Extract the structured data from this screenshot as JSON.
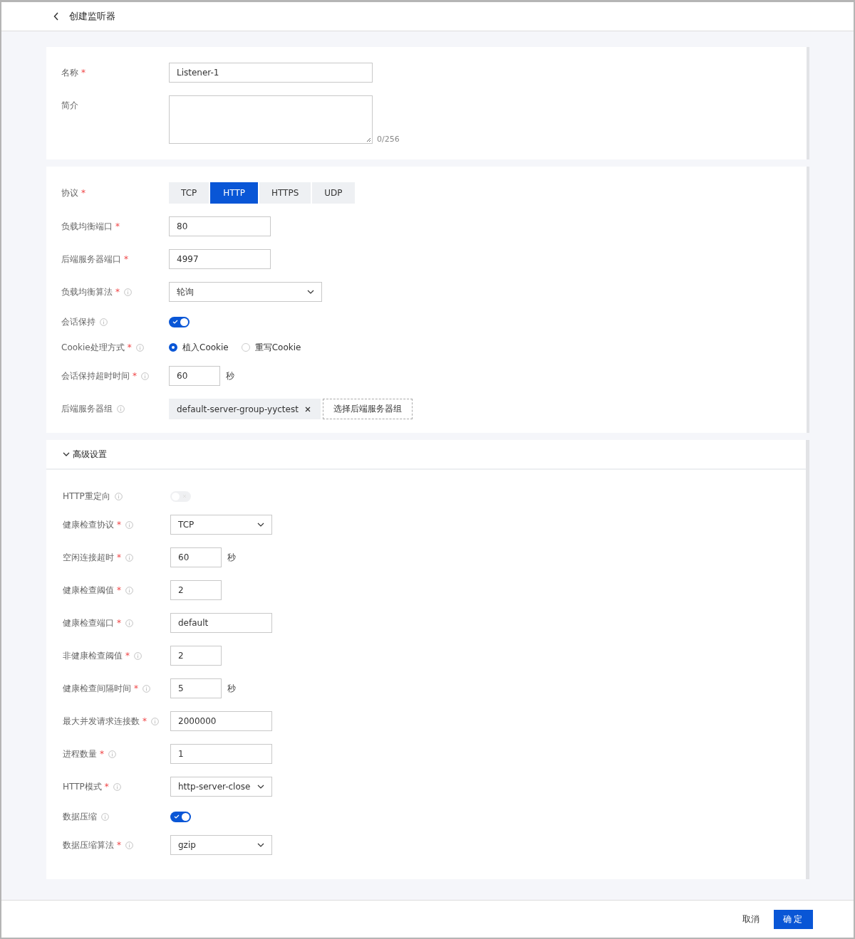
{
  "header": {
    "title": "创建监听器"
  },
  "basic": [
    {
      "kind": "text",
      "label": "名称",
      "mark": "*",
      "value": "Listener-1"
    },
    {
      "kind": "textarea",
      "label": "简介",
      "counter": "0/256"
    }
  ],
  "listener": [
    {
      "kind": "segmented",
      "label": "协议",
      "mark": "*",
      "options": [
        {
          "label": "TCP",
          "selected": false
        },
        {
          "label": "HTTP",
          "selected": true
        },
        {
          "label": "HTTPS",
          "selected": false
        },
        {
          "label": "UDP",
          "selected": false
        }
      ]
    },
    {
      "kind": "text",
      "label": "负载均衡端口",
      "mark": "*",
      "value": "80"
    },
    {
      "kind": "text",
      "label": "后端服务器端口",
      "mark": "*",
      "value": "4997"
    },
    {
      "kind": "select",
      "label": "负载均衡算法",
      "mark": "*",
      "info": true,
      "value": "轮询"
    },
    {
      "kind": "switch",
      "label": "会话保持",
      "info": true,
      "on": true,
      "disabled": false
    },
    {
      "kind": "radio",
      "label": "Cookie处理方式",
      "mark": "*",
      "info": true,
      "options": [
        {
          "label": "植入Cookie",
          "selected": true
        },
        {
          "label": "重写Cookie",
          "selected": false
        }
      ]
    },
    {
      "kind": "text",
      "label": "会话保持超时时间",
      "mark": "*",
      "info": true,
      "value": "60",
      "unit": "秒"
    },
    {
      "kind": "tags",
      "label": "后端服务器组",
      "info": true,
      "tags": [
        "default-server-group-yyctest"
      ],
      "action": "选择后端服务器组"
    }
  ],
  "advanced": {
    "title": "高级设置",
    "expanded": true,
    "fields": [
      {
        "kind": "switch",
        "label": "HTTP重定向",
        "info": true,
        "on": false,
        "disabled": true
      },
      {
        "kind": "select",
        "label": "健康检查协议",
        "mark": "*",
        "info": true,
        "value": "TCP"
      },
      {
        "kind": "text",
        "label": "空闲连接超时",
        "mark": "*",
        "info": true,
        "value": "60",
        "unit": "秒"
      },
      {
        "kind": "text",
        "label": "健康检查阈值",
        "mark": "*",
        "info": true,
        "value": "2"
      },
      {
        "kind": "text",
        "label": "健康检查端口",
        "mark": "*",
        "info": true,
        "value": "default"
      },
      {
        "kind": "text",
        "label": "非健康检查阈值",
        "mark": "*",
        "info": true,
        "value": "2"
      },
      {
        "kind": "text",
        "label": "健康检查间隔时间",
        "mark": "*",
        "info": true,
        "value": "5",
        "unit": "秒"
      },
      {
        "kind": "text",
        "label": "最大并发请求连接数",
        "mark": "*",
        "info": true,
        "value": "2000000"
      },
      {
        "kind": "text",
        "label": "进程数量",
        "mark": "*",
        "info": true,
        "value": "1"
      },
      {
        "kind": "select",
        "label": "HTTP模式",
        "mark": "*",
        "info": true,
        "value": "http-server-close"
      },
      {
        "kind": "switch",
        "label": "数据压缩",
        "info": true,
        "on": true,
        "disabled": false
      },
      {
        "kind": "select",
        "label": "数据压缩算法",
        "mark": "*",
        "info": true,
        "value": "gzip"
      }
    ]
  },
  "footer": {
    "cancel": "取消",
    "confirm": "确定"
  }
}
